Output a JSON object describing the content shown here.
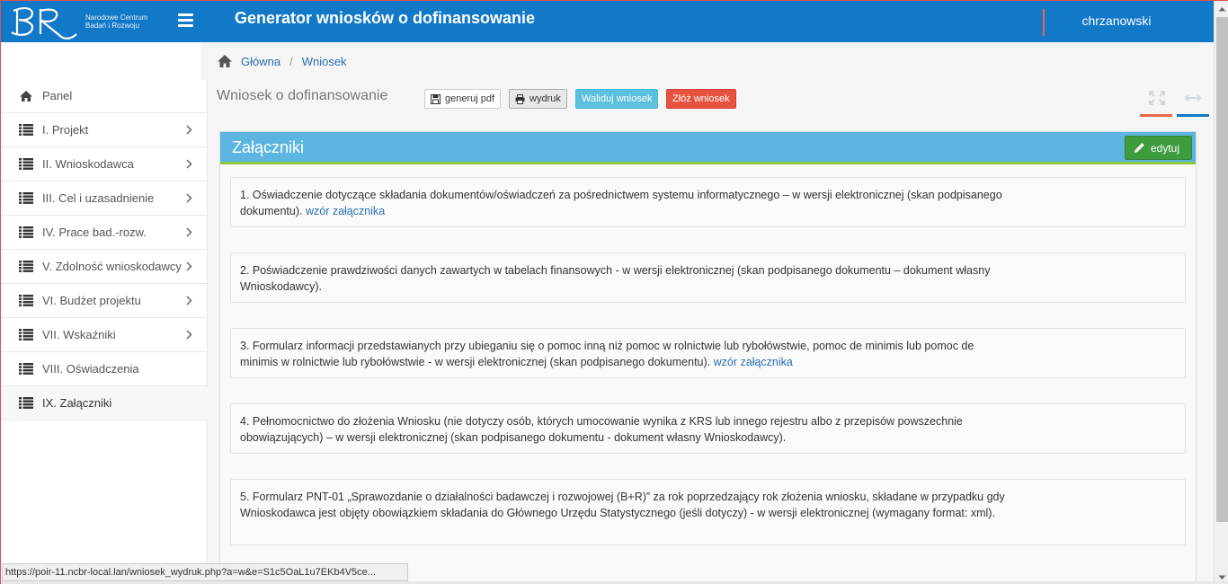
{
  "app": {
    "title": "Generator wniosków o dofinansowanie",
    "logo_line1": "Narodowe Centrum",
    "logo_line2": "Badań i Rozwoju",
    "user": "chrzanowski"
  },
  "breadcrumb": {
    "items": [
      "Główna",
      "Wniosek"
    ],
    "separator": "/"
  },
  "sidebar": {
    "items": [
      {
        "label": "Panel",
        "icon": "home-icon",
        "chevron": false,
        "active": false
      },
      {
        "label": "I. Projekt",
        "icon": "list-icon",
        "chevron": true,
        "active": false
      },
      {
        "label": "II. Wnioskodawca",
        "icon": "list-icon",
        "chevron": true,
        "active": false
      },
      {
        "label": "III. Cel i uzasadnienie",
        "icon": "list-icon",
        "chevron": true,
        "active": false
      },
      {
        "label": "IV. Prace bad.-rozw.",
        "icon": "list-icon",
        "chevron": true,
        "active": false
      },
      {
        "label": "V. Zdolność wnioskodawcy",
        "icon": "list-icon",
        "chevron": true,
        "active": false
      },
      {
        "label": "VI. Budżet projektu",
        "icon": "list-icon",
        "chevron": true,
        "active": false
      },
      {
        "label": "VII. Wskaźniki",
        "icon": "list-icon",
        "chevron": true,
        "active": false
      },
      {
        "label": "VIII. Oświadczenia",
        "icon": "list-icon",
        "chevron": false,
        "active": false
      },
      {
        "label": "IX. Załączniki",
        "icon": "list-icon",
        "chevron": false,
        "active": true
      }
    ]
  },
  "page": {
    "title": "Wniosek o dofinansowanie",
    "buttons": {
      "pdf": "generuj pdf",
      "print": "wydruk",
      "validate": "Waliduj wniosek",
      "submit": "Złóż wniosek"
    }
  },
  "panel": {
    "title": "Załączniki",
    "edit_label": "edytuj",
    "attachments": [
      {
        "text": "1. Oświadczenie dotyczące składania dokumentów/oświadczeń za pośrednictwem systemu informatycznego – w wersji elektronicznej (skan podpisanego dokumentu).",
        "link": "wzór załącznika"
      },
      {
        "text": "2. Poświadczenie prawdziwości danych zawartych w tabelach finansowych - w wersji elektronicznej (skan podpisanego dokumentu – dokument własny Wnioskodawcy).",
        "link": ""
      },
      {
        "text": "3. Formularz informacji przedstawianych przy ubieganiu się o pomoc inną niż pomoc w rolnictwie lub rybołówstwie, pomoc de minimis lub pomoc de minimis w rolnictwie lub rybołówstwie - w wersji elektronicznej (skan podpisanego dokumentu).",
        "link": "wzór załącznika"
      },
      {
        "text": "4. Pełnomocnictwo do złożenia Wniosku (nie dotyczy osób, których umocowanie wynika z KRS lub innego rejestru albo z przepisów powszechnie obowiązujących) – w wersji elektronicznej (skan podpisanego dokumentu - dokument własny Wnioskodawcy).",
        "link": ""
      },
      {
        "text": "5. Formularz PNT-01 „Sprawozdanie o działalności badawczej i rozwojowej (B+R)” za rok poprzedzający rok złożenia wniosku, składane w przypadku gdy Wnioskodawca jest objęty obowiązkiem składania do Głównego Urzędu Statystycznego (jeśli dotyczy) - w wersji elektronicznej (wymagany format: xml).",
        "link": ""
      }
    ]
  },
  "status_bar": {
    "url": "https://poir-11.ncbr-local.lan/wniosek_wydruk.php?a=w&e=S1c5OaL1u7EKb4V5ce..."
  },
  "colors": {
    "header": "#1278c8",
    "panel_head": "#5bb5e0",
    "panel_accent": "#8cc63f",
    "edit_button": "#3e9b3e",
    "validate_button": "#5bc0de",
    "submit_button": "#e8533f"
  }
}
